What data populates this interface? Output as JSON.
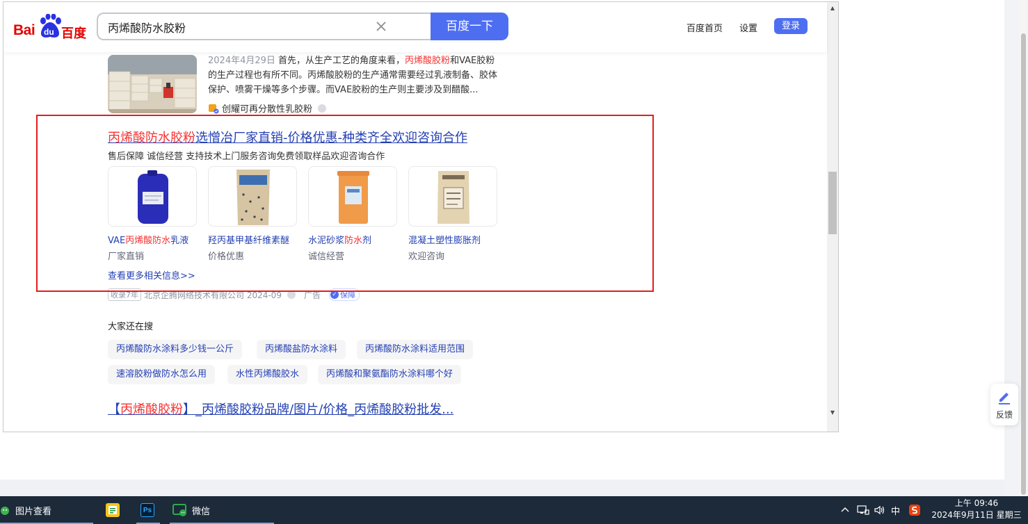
{
  "search": {
    "logo_text": "Bai",
    "logo_du": "du",
    "logo_cn": "百度",
    "query": "丙烯酸防水胶粉",
    "button_label": "百度一下"
  },
  "nav": {
    "home": "百度首页",
    "settings": "设置",
    "login": "登录"
  },
  "result1": {
    "date": "2024年4月29日",
    "snippet_1": " 首先，从生产工艺的角度来看，",
    "snippet_hl": "丙烯酸胶粉",
    "snippet_2": "和VAE胶粉的生产过程也有所不同。丙烯酸胶粉的生产通常需要经过乳液制备、胶体保护、喷雾干燥等多个步骤。而VAE胶粉的生产则主要涉及到醋酸...",
    "source": "创耀可再分散性乳胶粉"
  },
  "ad": {
    "title_hl": "丙烯酸防水胶粉",
    "title_rest": "选憎冶厂家直销-价格优惠-种类齐全欢迎咨询合作",
    "subtitle": "售后保障 诚信经营 支持技术上门服务咨询免费领取样品欢迎咨询合作",
    "products": [
      {
        "name_pre": "VAE",
        "name_hl": "丙烯酸防水",
        "name_post": "乳液",
        "tag": "厂家直销"
      },
      {
        "name_pre": "羟丙基甲基纤维素醚",
        "name_hl": "",
        "name_post": "",
        "tag": "价格优惠"
      },
      {
        "name_pre": "水泥砂浆",
        "name_hl": "防水",
        "name_post": "剂",
        "tag": "诚信经营"
      },
      {
        "name_pre": "混凝土塑性膨胀剂",
        "name_hl": "",
        "name_post": "",
        "tag": "欢迎咨询"
      }
    ],
    "more_link": "查看更多相关信息>>",
    "meta_badge": "收录7年",
    "meta_company": "北京企腾网络技术有限公司 2024-09",
    "meta_ad": "广告",
    "meta_guarantee": "保障"
  },
  "related": {
    "title": "大家还在搜",
    "chips": [
      "丙烯酸防水涂料多少钱一公斤",
      "丙烯酸盐防水涂料",
      "丙烯酸防水涂料适用范围",
      "速溶胶粉做防水怎么用",
      "水性丙烯酸胶水",
      "丙烯酸和聚氨酯防水涂料哪个好"
    ]
  },
  "next_result": {
    "title_pre": "【",
    "title_hl": "丙烯酸胶粉",
    "title_rest": "】_丙烯酸胶粉品牌/图片/价格_丙烯酸胶粉批发..."
  },
  "feedback": {
    "label": "反馈"
  },
  "taskbar": {
    "app_photo": "图片查看",
    "app_wechat": "微信",
    "ps_label": "Ps",
    "tray_ime": "中",
    "time": "上午 09:46",
    "date": "2024年9月11日 星期三"
  },
  "colors": {
    "accent": "#4e6ef2",
    "link": "#2440b3",
    "highlight": "#f73131",
    "brand_red": "#e10602",
    "box_red": "#e31c1c"
  },
  "icons": [
    "baidu-paw-icon",
    "clear-icon",
    "feedback-pen-icon",
    "wechat-icon",
    "photo-viewer-icon",
    "photoshop-icon",
    "chevron-up-icon",
    "network-icon",
    "volume-icon",
    "sogou-icon"
  ]
}
